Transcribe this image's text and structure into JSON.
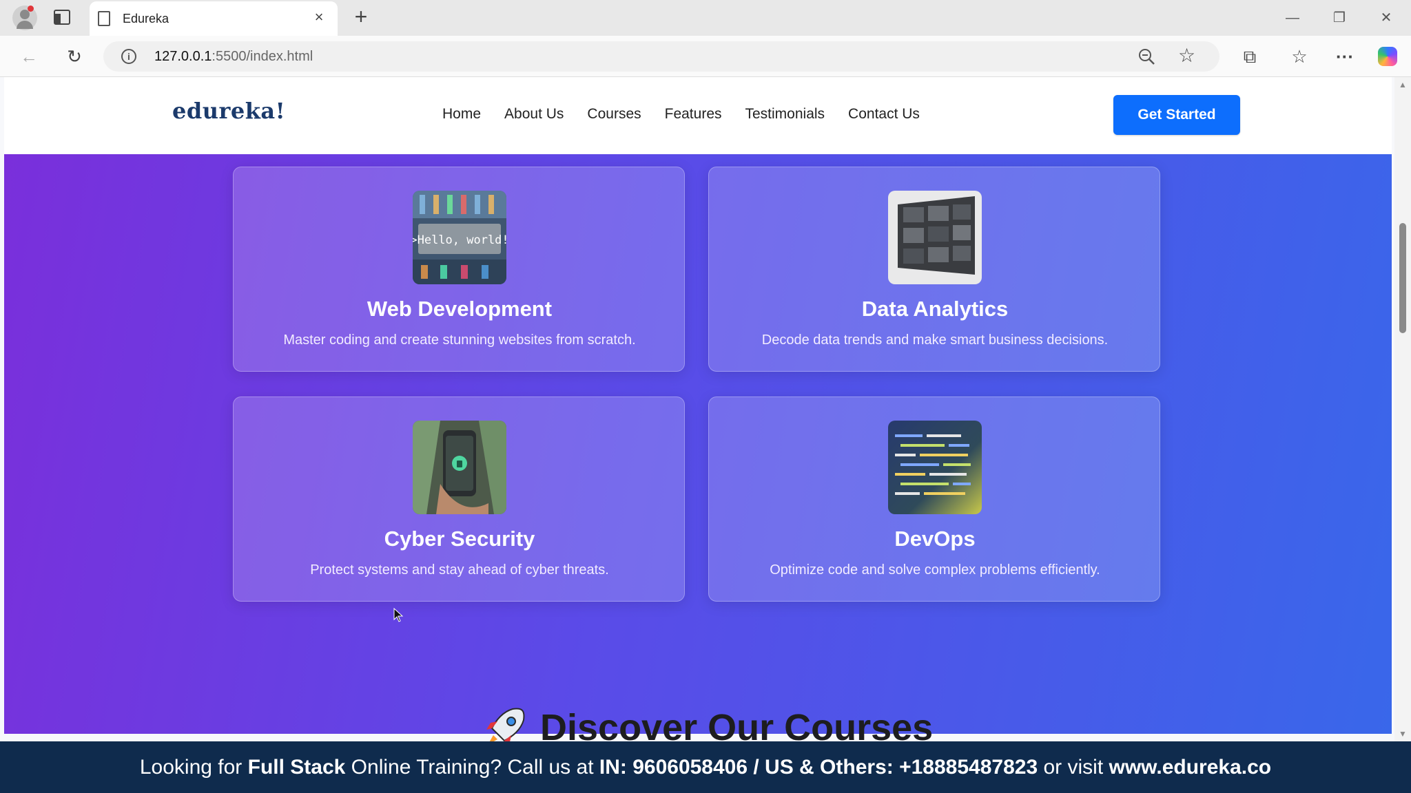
{
  "browser": {
    "tab_title": "Edureka",
    "tab_close": "×",
    "new_tab": "+",
    "url_host": "127.0.0.1",
    "url_rest": ":5500/index.html",
    "win_min": "—",
    "win_max": "❐",
    "win_close": "✕"
  },
  "site": {
    "logo": "edureka!",
    "nav": [
      "Home",
      "About Us",
      "Courses",
      "Features",
      "Testimonials",
      "Contact Us"
    ],
    "cta": "Get Started"
  },
  "cards": [
    {
      "title": "Web Development",
      "desc": "Master coding and create stunning websites from scratch.",
      "img_text": ">Hello, world!"
    },
    {
      "title": "Data Analytics",
      "desc": "Decode data trends and make smart business decisions."
    },
    {
      "title": "Cyber Security",
      "desc": "Protect systems and stay ahead of cyber threats."
    },
    {
      "title": "DevOps",
      "desc": "Optimize code and solve complex problems efficiently."
    }
  ],
  "section": {
    "title": "Discover Our Courses"
  },
  "banner": {
    "p1": "Looking for ",
    "b1": "Full Stack",
    "p2": " Online Training? Call us at ",
    "b2": "IN: 9606058406 / US & Others: +18885487823",
    "p3": " or visit ",
    "b3": "www.edureka.co"
  },
  "colors": {
    "cta": "#0d6efd",
    "banner": "#0f2b4d",
    "hero_start": "#7a2fdb",
    "hero_end": "#3967ea"
  }
}
